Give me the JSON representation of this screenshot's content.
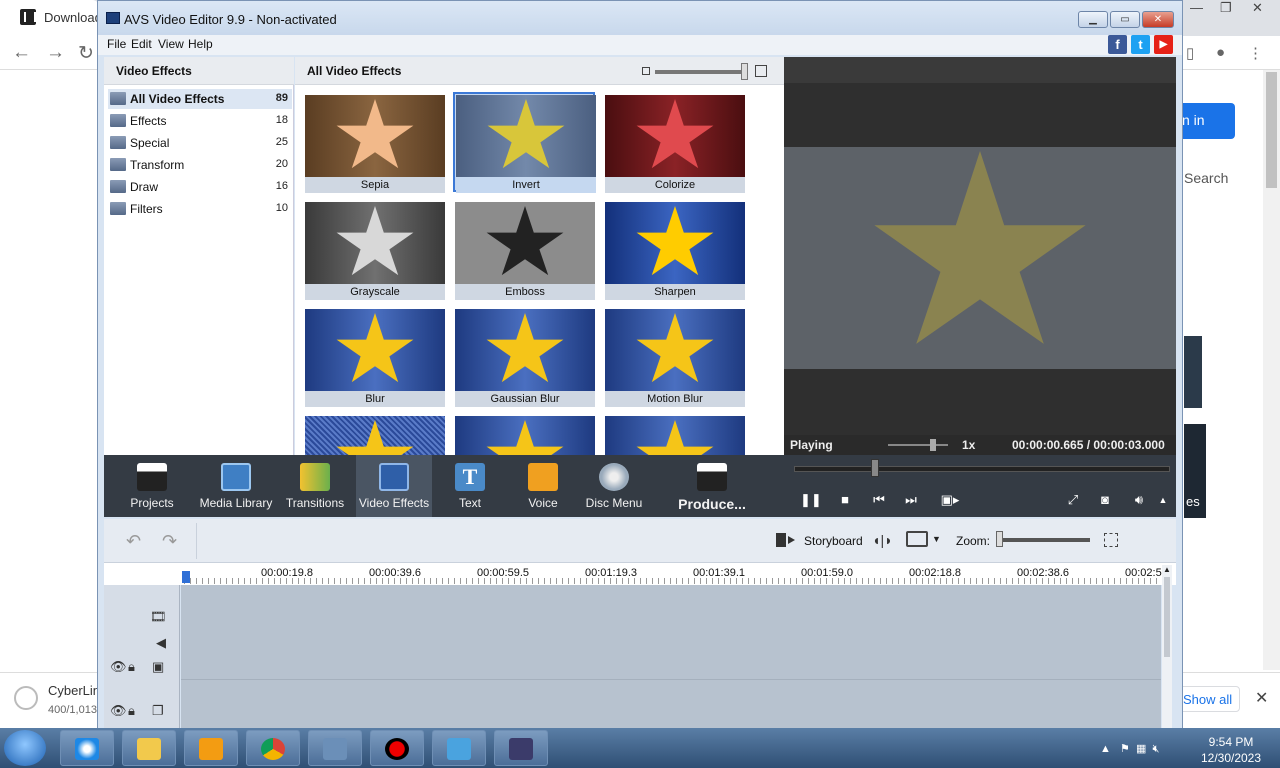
{
  "browser": {
    "tab_title": "Download",
    "search_text": "Search",
    "sign_in": "n in",
    "download_name": "CyberLin",
    "download_size": "400/1,013",
    "show_all": "Show all",
    "side_text": "es"
  },
  "window": {
    "title": "AVS Video Editor 9.9 - Non-activated",
    "menu": [
      "File",
      "Edit",
      "View",
      "Help"
    ]
  },
  "effects_panel": {
    "heading": "Video Effects",
    "categories": [
      {
        "name": "All Video Effects",
        "count": "89"
      },
      {
        "name": "Effects",
        "count": "18"
      },
      {
        "name": "Special",
        "count": "25"
      },
      {
        "name": "Transform",
        "count": "20"
      },
      {
        "name": "Draw",
        "count": "16"
      },
      {
        "name": "Filters",
        "count": "10"
      }
    ]
  },
  "gallery": {
    "heading": "All Video Effects",
    "tiles": [
      "Sepia",
      "Invert",
      "Colorize",
      "Grayscale",
      "Emboss",
      "Sharpen",
      "Blur",
      "Gaussian Blur",
      "Motion Blur"
    ],
    "selected": "Invert"
  },
  "preview": {
    "status": "Playing",
    "speed": "1x",
    "timecode": "00:00:00.665 / 00:00:03.000"
  },
  "toolbar": {
    "items": [
      "Projects",
      "Media Library",
      "Transitions",
      "Video Effects",
      "Text",
      "Voice",
      "Disc Menu",
      "Produce..."
    ],
    "active": "Video Effects"
  },
  "timeline": {
    "storyboard": "Storyboard",
    "zoom": "Zoom:",
    "ruler": [
      "00:00:19.8",
      "00:00:39.6",
      "00:00:59.5",
      "00:01:19.3",
      "00:01:39.1",
      "00:01:59.0",
      "00:02:18.8",
      "00:02:38.6",
      "00:02:5"
    ]
  },
  "taskbar": {
    "time": "9:54 PM",
    "date": "12/30/2023"
  },
  "colors": {
    "accent": "#3b78d6",
    "toolbar": "#343b44",
    "star": "#f5c518",
    "facebook": "#3b5998",
    "twitter": "#1da1f2",
    "youtube": "#e62117"
  }
}
